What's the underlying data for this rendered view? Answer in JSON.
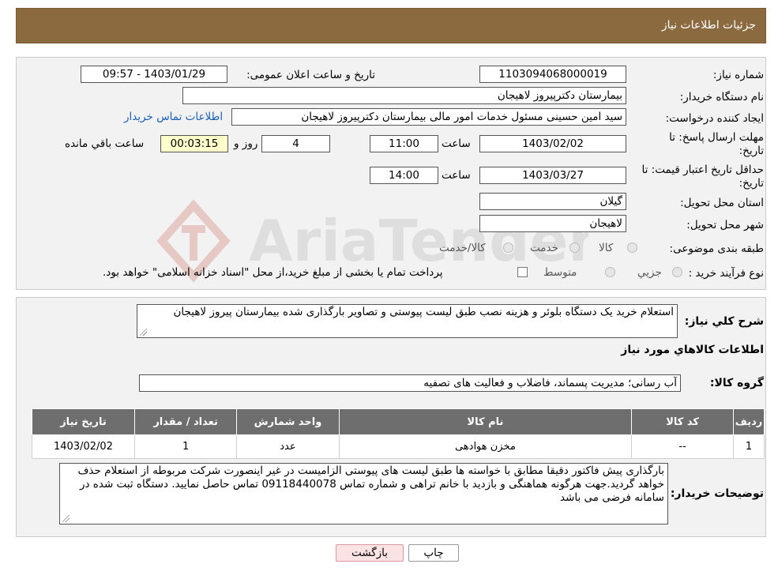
{
  "header": {
    "title": "جزئیات اطلاعات نیاز"
  },
  "info": {
    "need_number_label": "شماره نیاز:",
    "need_number": "1103094068000019",
    "announce_label": "تاریخ و ساعت اعلان عمومی:",
    "announce_value": "1403/01/29 - 09:57",
    "buyer_label": "نام دستگاه خریدار:",
    "buyer_value": "بیمارستان دکترپیروز لاهیجان",
    "creator_label": "ایجاد کننده درخواست:",
    "creator_value": "سید امین حسینی مسئول خدمات امور مالی بیمارستان دکترپیروز لاهیجان",
    "contact_link": "اطلاعات تماس خریدار",
    "deadline_label_1": "مهلت ارسال پاسخ: تا",
    "deadline_label_2": "تاریخ:",
    "deadline_date": "1403/02/02",
    "time_label": "ساعت",
    "deadline_time": "11:00",
    "days_value": "4",
    "days_label": "روز و",
    "remaining_value": "00:03:15",
    "remaining_label": "ساعت باقي مانده",
    "validity_label_1": "حداقل تاریخ اعتبار قیمت: تا",
    "validity_label_2": "تاریخ:",
    "validity_date": "1403/03/27",
    "validity_time": "14:00",
    "province_label": "استان محل تحویل:",
    "province_value": "گیلان",
    "city_label": "شهر محل تحویل:",
    "city_value": "لاهیجان",
    "category_label": "طبقه بندی موضوعی:",
    "category_options": [
      "کالا",
      "خدمت",
      "کالا/خدمت"
    ],
    "process_label": "نوع فرآیند خرید :",
    "process_options": [
      "جزیي",
      "متوسط"
    ],
    "payment_note": "پرداخت تمام یا بخشی از مبلغ خرید،از محل \"اسناد خزانه اسلامی\" خواهد بود."
  },
  "description": {
    "label": "شرح كلي نياز:",
    "text": "استعلام خرید یک دستگاه بلوئر و هزینه نصب طبق لیست پیوستی و تصاویر بارگذاری شده بیمارستان پیروز لاهیجان"
  },
  "goods": {
    "section_title": "اطلاعات كالاهاي مورد نياز",
    "group_label": "گروه کالا:",
    "group_value": "آب رسانی؛ مدیریت پسماند، فاضلاب و فعالیت های تصفیه",
    "columns": [
      "رديف",
      "كد كالا",
      "نام كالا",
      "واحد شمارش",
      "تعداد / مقدار",
      "تاريخ نياز"
    ],
    "rows": [
      [
        "1",
        "--",
        "مخزن هوادهی",
        "عدد",
        "1",
        "1403/02/02"
      ]
    ]
  },
  "buyer_notes": {
    "label": "توضیحات خریدار:",
    "text": "بارگذاری پیش فاکتور دقیقا مطابق با خواسته ها طبق لیست های پیوستی الزامیست در غیر اینصورت شرکت مربوطه از استعلام حذف خواهد گردید.جهت هرگونه هماهنگی و بازدید با خانم تراهی و شماره تماس 09118440078 تماس حاصل نمایید. دستگاه ثبت شده در سامانه فرضی می باشد"
  },
  "buttons": {
    "print": "چاپ",
    "back": "بازگشت"
  },
  "watermark": {
    "text": "AriaTender.net"
  },
  "colors": {
    "header": "#8c6a3f",
    "link": "#1a5fb4",
    "table_header": "#6e6e6e"
  }
}
